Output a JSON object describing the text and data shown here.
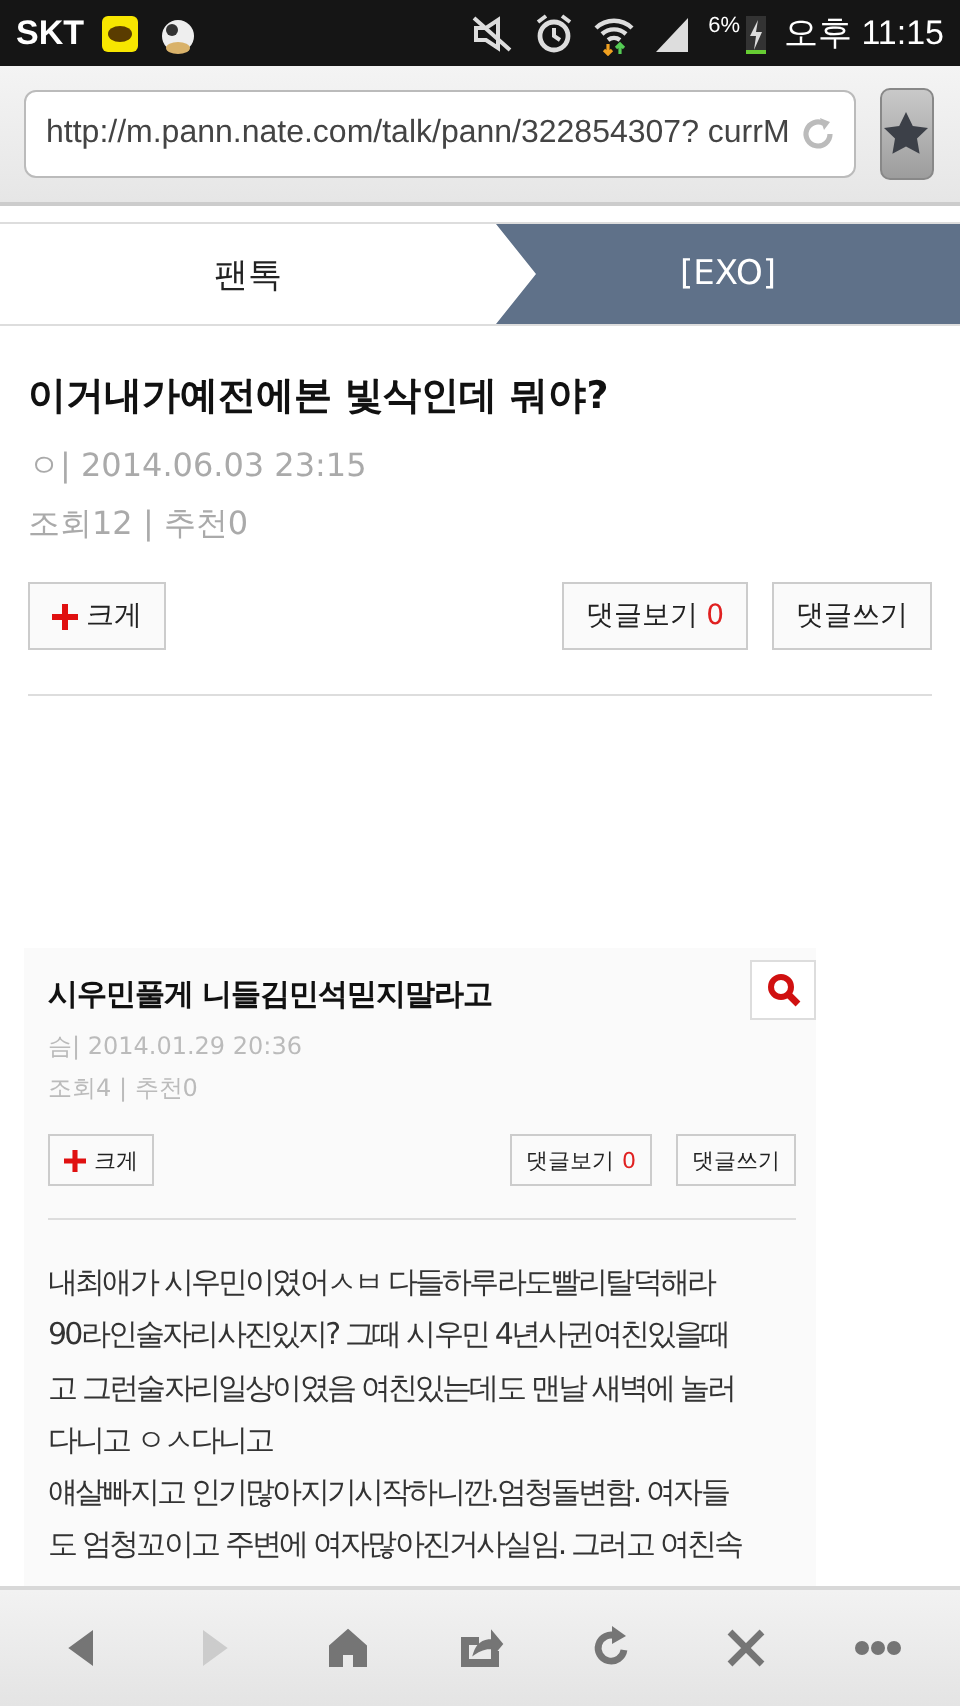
{
  "status_bar": {
    "carrier": "SKT",
    "battery": "6%",
    "time": "오후 11:15"
  },
  "browser": {
    "url": "http://m.pann.nate.com/talk/pann/322854307? currM"
  },
  "breadcrumb": [
    {
      "label": "팬톡",
      "selected": false
    },
    {
      "label": "[EXO]",
      "selected": true
    }
  ],
  "post": {
    "title": "이거내가예전에본 빛삭인데 뭐야?",
    "meta": "ㅇ| 2014.06.03 23:15",
    "stats": "조회12 | 추천0",
    "enlarge": "크게",
    "view_comments": "댓글보기",
    "comment_count": "0",
    "write_comment": "댓글쓰기"
  },
  "embedded_post": {
    "title": "시우민풀게 니들김민석믿지말라고",
    "meta": "슴| 2014.01.29 20:36",
    "stats": "조회4 | 추천0",
    "enlarge": "크게",
    "view_comments": "댓글보기",
    "comment_count": "0",
    "write_comment": "댓글쓰기",
    "body_lines": [
      "내최애가 시우민이였어ㅅㅂ 다들하루라도빨리탈덕해라",
      "90라인술자리사진있지? 그때 시우민 4년사귄여친있을때",
      "고 그런술자리일상이였음 여친있는데도 맨날 새벽에 놀러",
      "다니고 ㅇㅅ다니고",
      "얘살빠지고 인기많아지기시작하니깐.엄청돌변함. 여자들",
      "도 엄청꼬이고 주변에 여자많아진거사실임. 그러고 여친속"
    ]
  },
  "nav": [
    {
      "kind": "back",
      "disabled": false
    },
    {
      "kind": "forward",
      "disabled": true
    },
    {
      "kind": "home",
      "disabled": false
    },
    {
      "kind": "share",
      "disabled": false
    },
    {
      "kind": "refresh",
      "disabled": false
    },
    {
      "kind": "close",
      "disabled": false
    },
    {
      "kind": "more",
      "disabled": false
    }
  ]
}
